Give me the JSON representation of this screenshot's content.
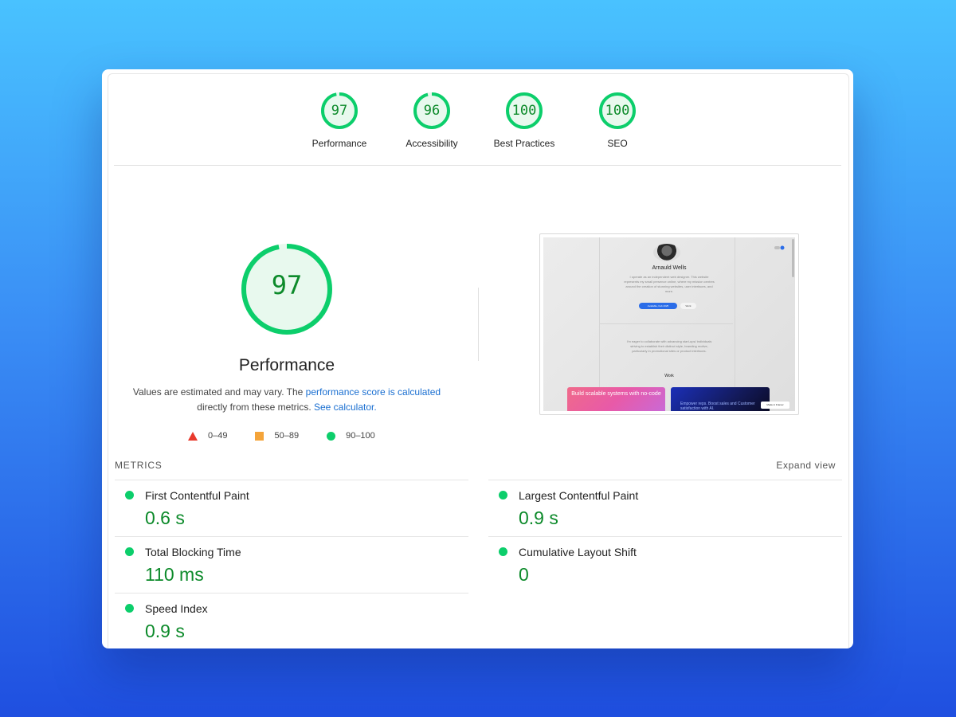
{
  "categories": [
    {
      "score": "97",
      "label": "Performance"
    },
    {
      "score": "96",
      "label": "Accessibility"
    },
    {
      "score": "100",
      "label": "Best Practices"
    },
    {
      "score": "100",
      "label": "SEO"
    }
  ],
  "main": {
    "score": "97",
    "title": "Performance",
    "desc_part1": "Values are estimated and may vary. The ",
    "desc_link1": "performance score is calculated",
    "desc_part2": " directly from these metrics. ",
    "desc_link2": "See calculator."
  },
  "legend": [
    {
      "range": "0–49",
      "icon": "red-triangle-icon"
    },
    {
      "range": "50–89",
      "icon": "orange-square-icon"
    },
    {
      "range": "90–100",
      "icon": "green-circle-icon"
    }
  ],
  "preview": {
    "name": "Arnauld Wells",
    "intro": "I operate as an independent web designer. This website represents my small presence online, where my mission centres around the creation of stunning websites, user interfaces, and more.",
    "btn1": "Available, Feb 2025",
    "btn2": "Work",
    "collab": "I'm eager to collaborate with advancing start-ups/ individuals striving to establish their distinct style, branding motive, particularly in promotional sites or product interfaces.",
    "work": "Work",
    "card1": "Build scalable systems with no-code",
    "card2": "Empower reps. Boost sales and Customer satisfaction with AI.",
    "badge": "Made in Framer"
  },
  "metrics": {
    "title": "METRICS",
    "expand": "Expand view",
    "items": [
      {
        "label": "First Contentful Paint",
        "value": "0.6 s"
      },
      {
        "label": "Largest Contentful Paint",
        "value": "0.9 s"
      },
      {
        "label": "Total Blocking Time",
        "value": "110 ms"
      },
      {
        "label": "Cumulative Layout Shift",
        "value": "0"
      },
      {
        "label": "Speed Index",
        "value": "0.9 s"
      }
    ]
  },
  "colors": {
    "pass": "#0cce6b",
    "pass_text": "#0c8a2a",
    "link": "#1a6fd1",
    "fail": "#e8392c",
    "average": "#f4a43a"
  }
}
